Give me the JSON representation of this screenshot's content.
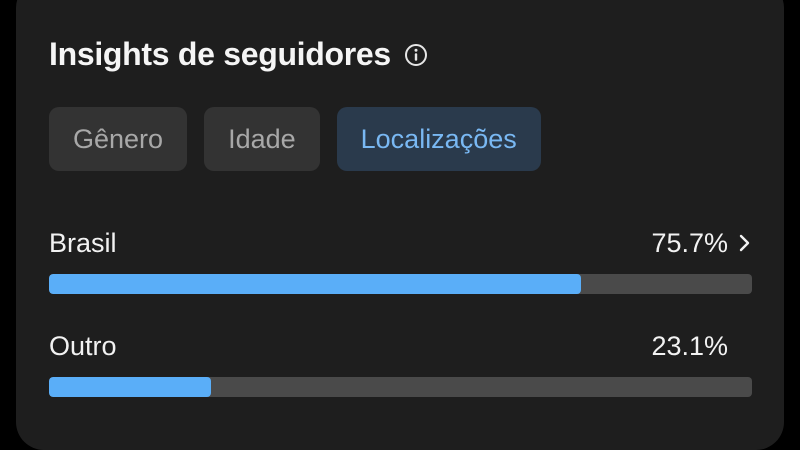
{
  "header": {
    "title": "Insights de seguidores",
    "info_icon": "info-circle-icon"
  },
  "tabs": [
    {
      "label": "Gênero",
      "active": false
    },
    {
      "label": "Idade",
      "active": false
    },
    {
      "label": "Localizações",
      "active": true
    }
  ],
  "locations": [
    {
      "label": "Brasil",
      "value_text": "75.7%",
      "value": 75.7,
      "has_chevron": true
    },
    {
      "label": "Outro",
      "value_text": "23.1%",
      "value": 23.1,
      "has_chevron": false
    }
  ],
  "colors": {
    "bar_fill": "#5aaef8",
    "bar_track": "#4a4a4a",
    "active_tab_text": "#79b8f3"
  }
}
